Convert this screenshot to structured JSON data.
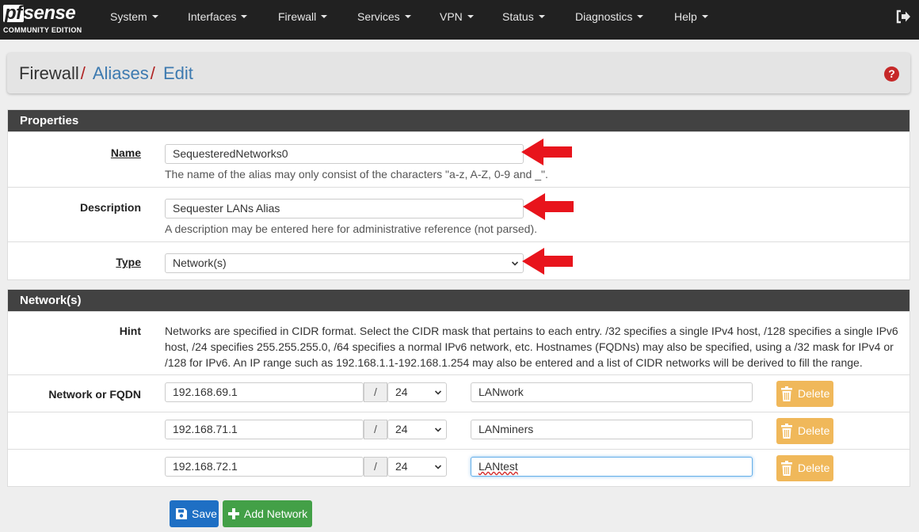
{
  "brand": {
    "logo_top": "sense",
    "logo_pf": "pf",
    "logo_bottom": "COMMUNITY EDITION"
  },
  "nav": [
    {
      "label": "System"
    },
    {
      "label": "Interfaces"
    },
    {
      "label": "Firewall"
    },
    {
      "label": "Services"
    },
    {
      "label": "VPN"
    },
    {
      "label": "Status"
    },
    {
      "label": "Diagnostics"
    },
    {
      "label": "Help"
    }
  ],
  "breadcrumb": {
    "root": "Firewall",
    "level1": "Aliases",
    "level2": "Edit",
    "sep": "/"
  },
  "help_icon": "?",
  "properties": {
    "header": "Properties",
    "name": {
      "label": "Name",
      "value": "SequesteredNetworks0",
      "help": "The name of the alias may only consist of the characters \"a-z, A-Z, 0-9 and _\"."
    },
    "description": {
      "label": "Description",
      "value": "Sequester LANs Alias",
      "help": "A description may be entered here for administrative reference (not parsed)."
    },
    "type": {
      "label": "Type",
      "value": "Network(s)"
    }
  },
  "networks": {
    "header": "Network(s)",
    "hint_label": "Hint",
    "hint_lines": [
      "Networks are specified in CIDR format. Select the CIDR mask that pertains to each entry. /32 specifies a single IPv4 host, /128 specifies a single IPv6",
      "host, /24 specifies 255.255.255.0, /64 specifies a normal IPv6 network, etc. Hostnames (FQDNs) may also be specified, using a /32 mask for IPv4 or",
      "/128 for IPv6. An IP range such as 192.168.1.1-192.168.1.254 may also be entered and a list of CIDR networks will be derived to fill the range."
    ],
    "row_label": "Network or FQDN",
    "slash": "/",
    "delete_label": "Delete",
    "entries": [
      {
        "address": "192.168.69.1",
        "mask": "24",
        "description": "LANwork"
      },
      {
        "address": "192.168.71.1",
        "mask": "24",
        "description": "LANminers"
      },
      {
        "address": "192.168.72.1",
        "mask": "24",
        "description": "LANtest"
      }
    ]
  },
  "buttons": {
    "save": "Save",
    "add_network": "Add Network"
  },
  "colors": {
    "navbar": "#212121",
    "panel_header": "#424242",
    "link": "#3d7ab0",
    "separator": "#b02424",
    "delete": "#f0b85a",
    "save": "#1e6fc4",
    "add": "#43a047",
    "annotation_arrow": "#e8141c"
  }
}
